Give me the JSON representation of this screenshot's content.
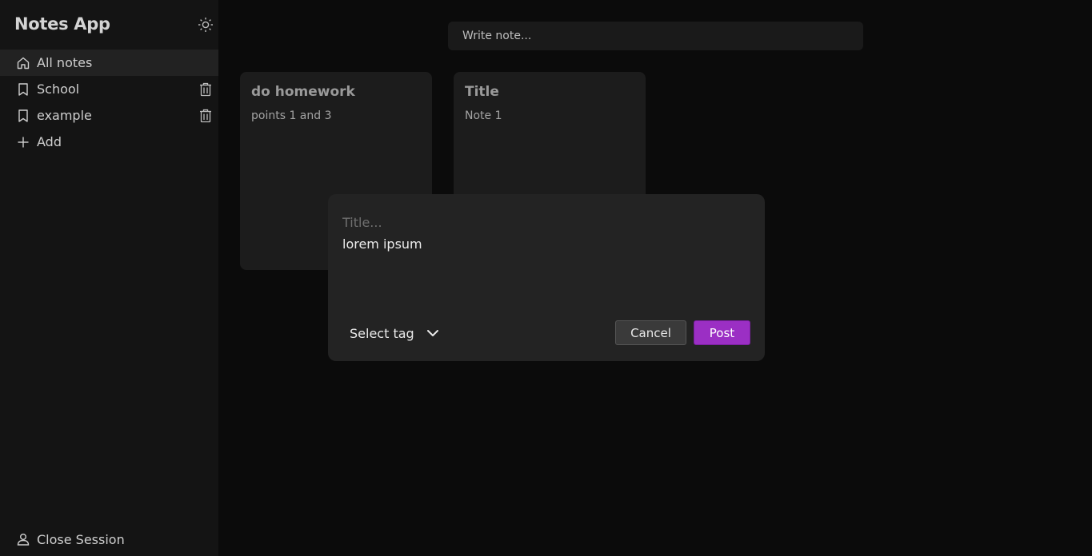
{
  "app": {
    "title": "Notes App"
  },
  "sidebar": {
    "items": [
      {
        "label": "All notes",
        "icon": "home-icon",
        "active": true
      },
      {
        "label": "School",
        "icon": "bookmark-icon",
        "deletable": true
      },
      {
        "label": "example",
        "icon": "bookmark-icon",
        "deletable": true
      },
      {
        "label": "Add",
        "icon": "plus-icon"
      }
    ],
    "close_session": "Close Session"
  },
  "search": {
    "placeholder": "Write note..."
  },
  "notes": [
    {
      "title": "do homework",
      "body": "points 1 and 3"
    },
    {
      "title": "Title",
      "body": "Note 1"
    }
  ],
  "modal": {
    "title_placeholder": "Title...",
    "body_value": "lorem ipsum",
    "tag_select": "Select tag",
    "cancel_label": "Cancel",
    "post_label": "Post"
  },
  "colors": {
    "accent": "#9b2fc4",
    "background": "#0b0b0b",
    "sidebar": "#141414",
    "card": "#1c1c1c",
    "modal": "#232323"
  }
}
